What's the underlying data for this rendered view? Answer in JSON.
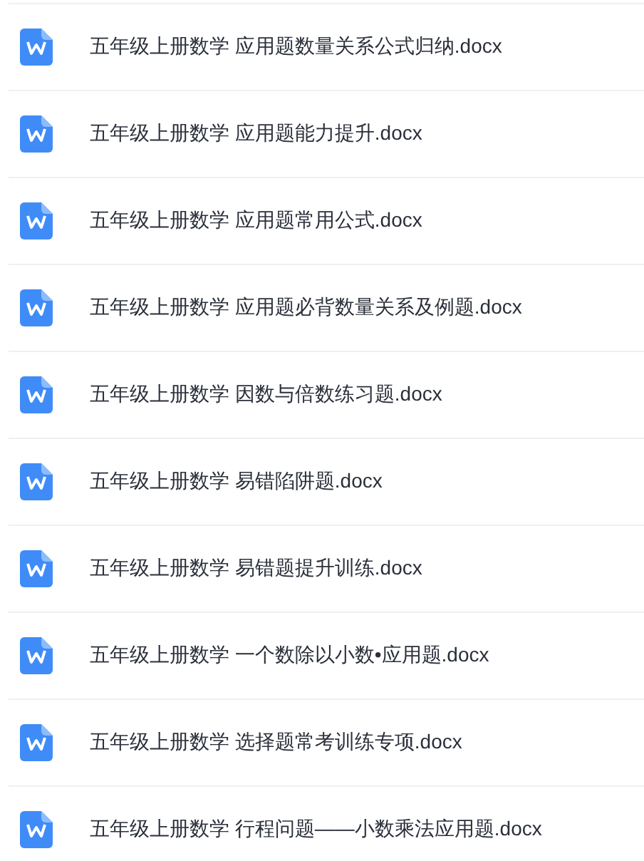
{
  "files": [
    {
      "name": "五年级上册数学 应用题数量关系公式归纳.docx"
    },
    {
      "name": "五年级上册数学 应用题能力提升.docx"
    },
    {
      "name": "五年级上册数学 应用题常用公式.docx"
    },
    {
      "name": "五年级上册数学 应用题必背数量关系及例题.docx"
    },
    {
      "name": "五年级上册数学 因数与倍数练习题.docx"
    },
    {
      "name": "五年级上册数学 易错陷阱题.docx"
    },
    {
      "name": "五年级上册数学 易错题提升训练.docx"
    },
    {
      "name": "五年级上册数学 一个数除以小数•应用题.docx"
    },
    {
      "name": "五年级上册数学 选择题常考训练专项.docx"
    },
    {
      "name": "五年级上册数学 行程问题——小数乘法应用题.docx"
    }
  ]
}
